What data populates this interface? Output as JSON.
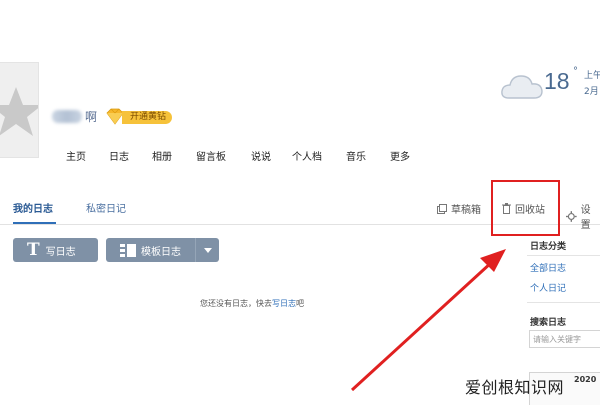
{
  "profile": {
    "name_tail": "啊",
    "vip_label": "开通黄钻"
  },
  "nav": [
    "主页",
    "日志",
    "相册",
    "留言板",
    "说说",
    "个人档",
    "音乐",
    "更多"
  ],
  "weather": {
    "temperature": "18",
    "degree": "°",
    "ampm": "上午",
    "date": "2月",
    "icon": "cloud-icon"
  },
  "tabs": {
    "my_diary": "我的日志",
    "private_diary": "私密日记"
  },
  "toolbar": {
    "drafts": "草稿箱",
    "recycle_bin": "回收站",
    "settings": "设置"
  },
  "buttons": {
    "write_icon": "T",
    "write": "写日志",
    "template": "模板日志"
  },
  "empty": {
    "text": "您还没有日志，快去",
    "link": "写日志",
    "suffix": "吧"
  },
  "sidebar": {
    "category_title": "日志分类",
    "all": "全部日志",
    "personal": "个人日记",
    "search_title": "搜索日志",
    "search_placeholder": "请输入关键字",
    "calendar_year": "2020"
  },
  "watermark": {
    "text": "爱创根知识网"
  },
  "colors": {
    "accent": "#2f6fb8",
    "button": "#7f91a6",
    "highlight": "#e02020",
    "vip": "#f6c23a"
  }
}
